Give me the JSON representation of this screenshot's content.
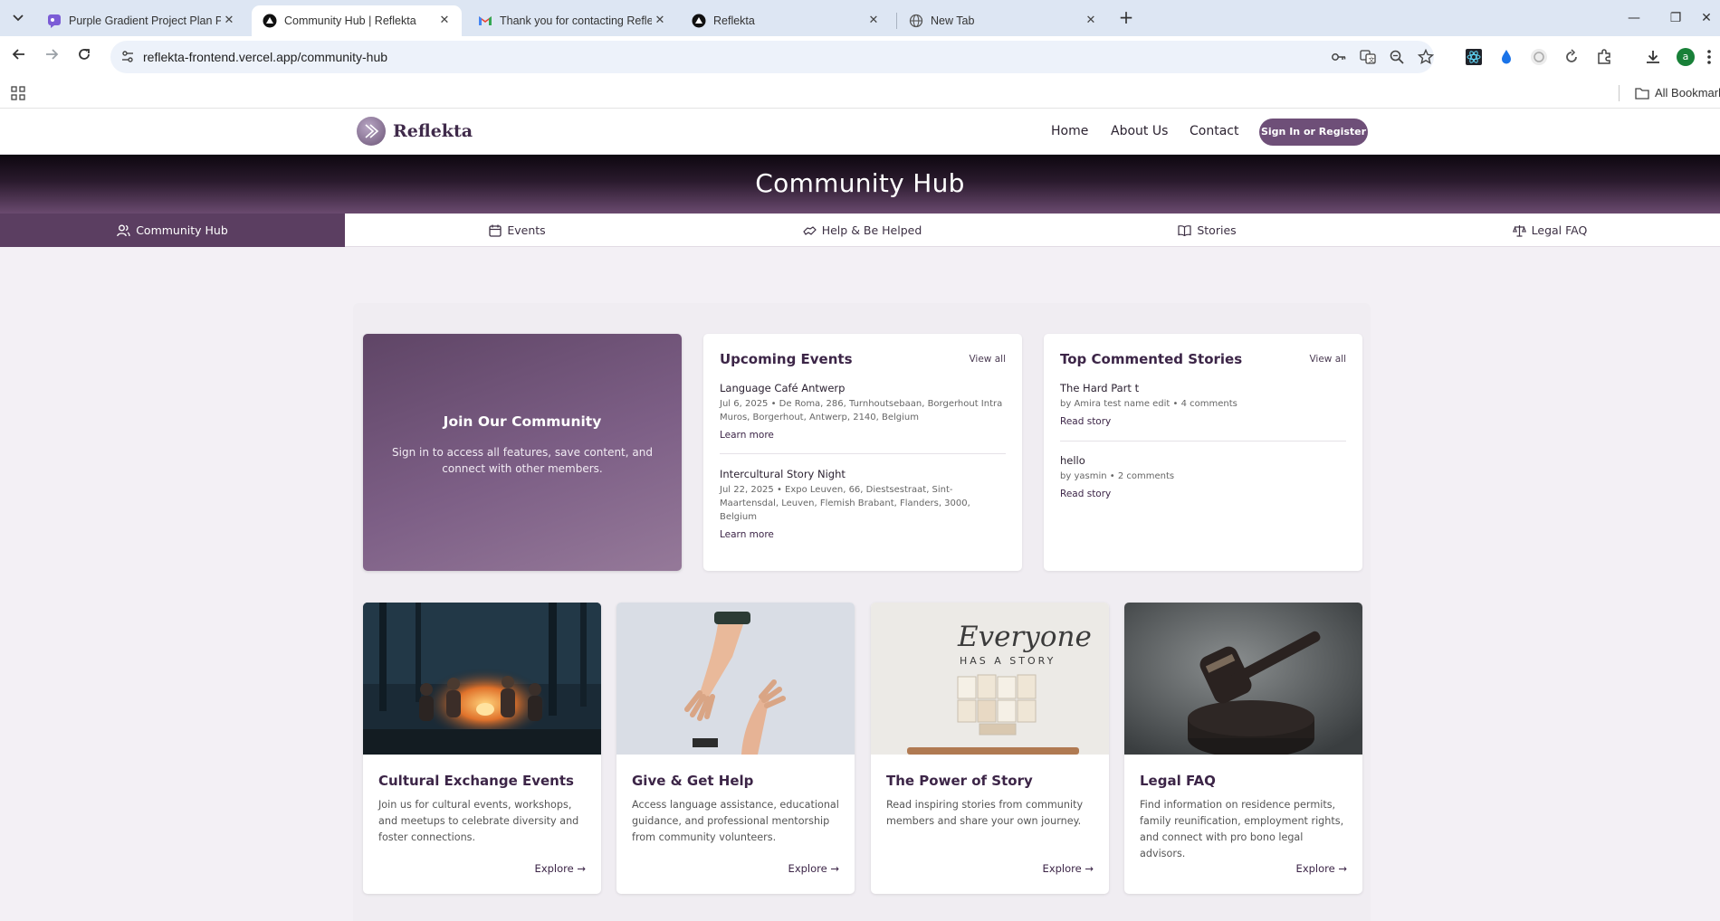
{
  "browser": {
    "tabs": [
      {
        "title": "Purple Gradient Project Plan Pr",
        "active": false
      },
      {
        "title": "Community Hub | Reflekta",
        "active": true
      },
      {
        "title": "Thank you for contacting Reflek",
        "active": false
      },
      {
        "title": "Reflekta",
        "active": false
      },
      {
        "title": "New Tab",
        "active": false
      }
    ],
    "url_host": "reflekta-frontend.vercel.app",
    "url_path": "/community-hub",
    "all_bookmarks": "All Bookmarks",
    "profile_initial": "a"
  },
  "site": {
    "logo_text": "Reflekta",
    "nav": {
      "home": "Home",
      "about": "About Us",
      "contact": "Contact"
    },
    "signin_label": "Sign In or Register"
  },
  "hero": {
    "title": "Community Hub"
  },
  "subnav": {
    "community_hub": "Community Hub",
    "events": "Events",
    "help": "Help & Be Helped",
    "stories": "Stories",
    "legal": "Legal FAQ"
  },
  "join": {
    "title": "Join Our Community",
    "text": "Sign in to access all features, save content, and connect with other members."
  },
  "events_card": {
    "title": "Upcoming Events",
    "view_all": "View all",
    "items": [
      {
        "title": "Language Café Antwerp",
        "meta": "Jul 6, 2025 • De Roma, 286, Turnhoutsebaan, Borgerhout Intra Muros, Borgerhout, Antwerp, 2140, Belgium",
        "link": "Learn more"
      },
      {
        "title": "Intercultural Story Night",
        "meta": "Jul 22, 2025 • Expo Leuven, 66, Diestsestraat, Sint-Maartensdal, Leuven, Flemish Brabant, Flanders, 3000, Belgium",
        "link": "Learn more"
      }
    ]
  },
  "stories_card": {
    "title": "Top Commented Stories",
    "view_all": "View all",
    "items": [
      {
        "title": "The Hard Part t",
        "meta": "by Amira test name edit • 4 comments",
        "link": "Read story"
      },
      {
        "title": "hello",
        "meta": "by yasmin • 2 comments",
        "link": "Read story"
      }
    ]
  },
  "features": [
    {
      "title": "Cultural Exchange Events",
      "desc": "Join us for cultural events, workshops, and meetups to celebrate diversity and foster connections.",
      "explore": "Explore →"
    },
    {
      "title": "Give & Get Help",
      "desc": "Access language assistance, educational guidance, and professional mentorship from community volunteers.",
      "explore": "Explore →"
    },
    {
      "title": "The Power of Story",
      "desc": "Read inspiring stories from community members and share your own journey.",
      "explore": "Explore →",
      "image_text_1": "Everyone",
      "image_text_2": "HAS A STORY"
    },
    {
      "title": "Legal FAQ",
      "desc": "Find information on residence permits, family reunification, employment rights, and connect with pro bono legal advisors.",
      "explore": "Explore →"
    }
  ],
  "colors": {
    "brand": "#5b3e61",
    "brand_dark": "#3c2547",
    "accent_button": "#6e4f78"
  }
}
